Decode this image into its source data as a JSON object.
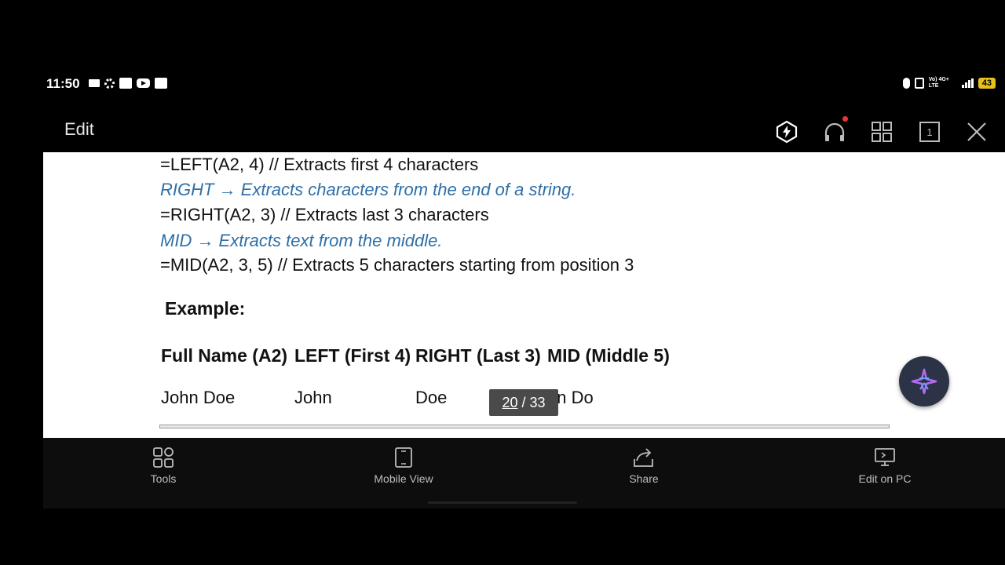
{
  "status_bar": {
    "time": "11:50",
    "left_icons": [
      "video-icon",
      "gear-icon",
      "link-icon",
      "youtube-icon",
      "message-icon"
    ],
    "network_label": "Vo) 4G+ LTE",
    "battery": "43"
  },
  "app_bar": {
    "edit_label": "Edit",
    "icons": [
      "lightning-badge-icon",
      "headphones-icon",
      "grid-icon",
      "page-count-icon",
      "close-icon"
    ],
    "page_icon_number": "1"
  },
  "document": {
    "lines": [
      "=LEFT(A2, 4)  // Extracts first 4 characters",
      "RIGHT → Extracts characters from the end of a string.",
      "=RIGHT(A2, 3)  // Extracts last 3 characters",
      "MID → Extracts text from the middle.",
      "=MID(A2, 3, 5)  // Extracts 5 characters starting from position 3"
    ],
    "example_heading": "Example:",
    "table": {
      "headers": [
        "Full Name (A2)",
        "LEFT (First 4)",
        "RIGHT (Last 3)",
        "MID (Middle 5)"
      ],
      "row": [
        "John Doe",
        "John",
        "Doe",
        "hn Do"
      ]
    },
    "pager": {
      "current": "20",
      "separator": " / ",
      "total": "33"
    }
  },
  "bottom_bar": {
    "items": [
      {
        "label": "Tools",
        "icon": "tools-icon"
      },
      {
        "label": "Mobile View",
        "icon": "mobile-view-icon"
      },
      {
        "label": "Share",
        "icon": "share-icon"
      },
      {
        "label": "Edit on PC",
        "icon": "edit-on-pc-icon"
      }
    ]
  },
  "colors": {
    "blue_text": "#2e6fa8",
    "battery": "#e8c21a",
    "notification_dot": "#e53935"
  }
}
